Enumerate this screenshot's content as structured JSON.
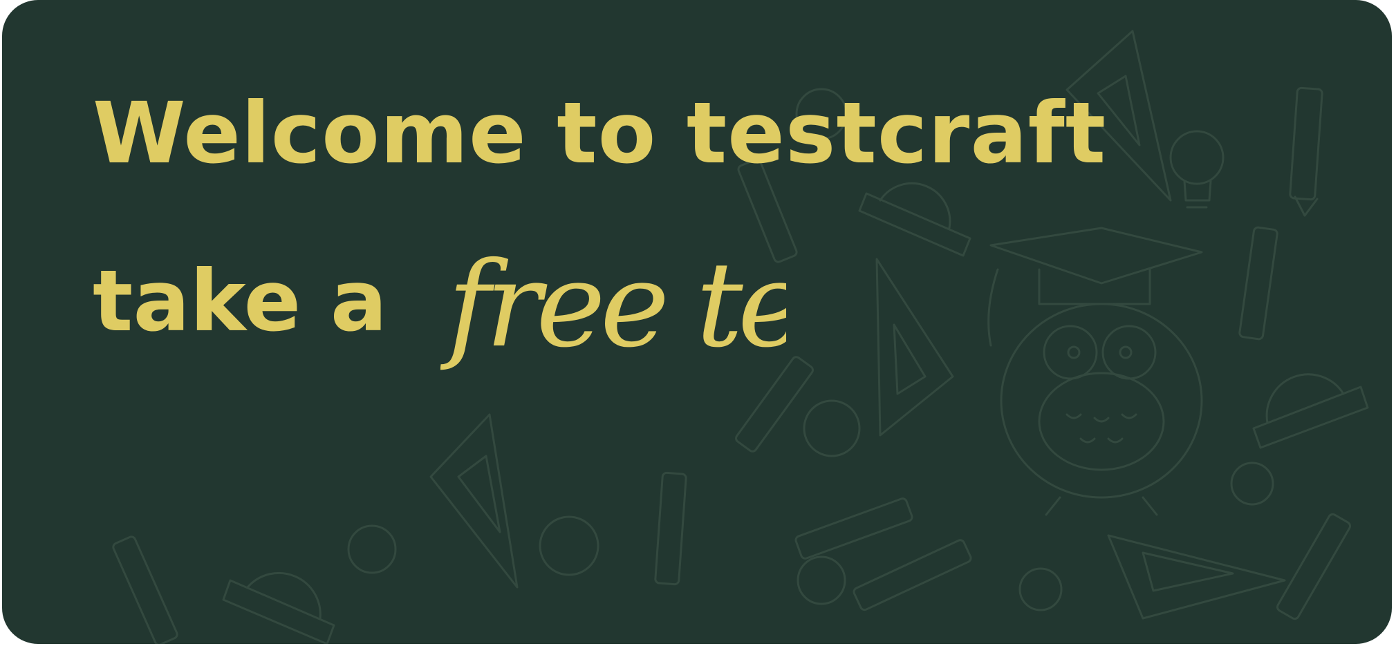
{
  "banner": {
    "headline": "Welcome to testcraft",
    "subline": "take a",
    "script_text": "free test"
  },
  "colors": {
    "background": "#223730",
    "accent": "#dfcc63",
    "doodle_stroke": "#33493f"
  },
  "icons": [
    "owl-graduate-icon",
    "pencil-icon",
    "lightbulb-icon",
    "protractor-icon",
    "set-square-icon"
  ]
}
